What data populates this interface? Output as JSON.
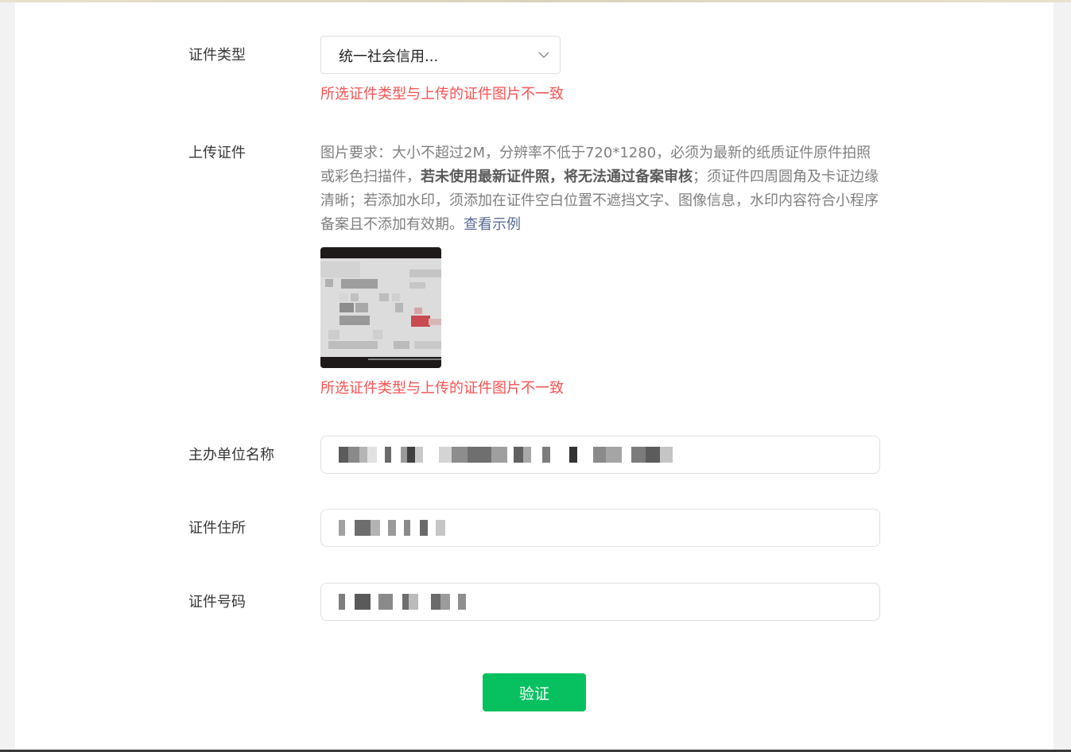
{
  "form": {
    "cert_type": {
      "label": "证件类型",
      "selected": "统一社会信用...",
      "error": "所选证件类型与上传的证件图片不一致"
    },
    "upload": {
      "label": "上传证件",
      "req_part1": "图片要求：大小不超过2M，分辨率不低于720*1280，必须为最新的纸质证件原件拍照或彩色扫描件，",
      "req_bold": "若未使用最新证件照，将无法通过备案审核",
      "req_part2": "；须证件四周圆角及卡证边缘清晰；若添加水印，须添加在证件空白位置不遮挡文字、图像信息，水印内容符合小程序备案且不添加有效期。",
      "example_link": "查看示例",
      "error": "所选证件类型与上传的证件图片不一致"
    },
    "org_name": {
      "label": "主办单位名称"
    },
    "cert_address": {
      "label": "证件住所"
    },
    "cert_number": {
      "label": "证件号码"
    },
    "verify_button": "验证"
  },
  "colors": {
    "error": "#fa5151",
    "primary": "#07c160",
    "link": "#576b95"
  }
}
